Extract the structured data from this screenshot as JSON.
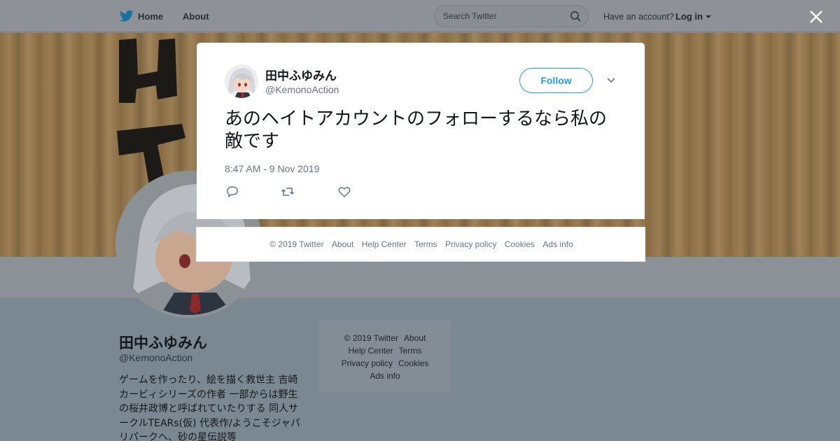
{
  "nav": {
    "home_label": "Home",
    "about_label": "About",
    "search_placeholder": "Search Twitter",
    "account_prompt": "Have an account?",
    "login_label": "Log in"
  },
  "profile": {
    "name": "田中ふゆみん",
    "handle": "@KemonoAction",
    "bio": "ゲームを作ったり、絵を描く救世主 吉崎カービィシリーズの作者 一部からは野生の桜井政博と呼ばれていたりする 同人サークルTEARs(仮) 代表作/ようこそジャパリパークへ、砂の星伝説等"
  },
  "side_footer": {
    "links": [
      "© 2019 Twitter",
      "About",
      "Help Center",
      "Terms",
      "Privacy policy",
      "Cookies",
      "Ads info"
    ]
  },
  "tweet": {
    "author_name": "田中ふゆみん",
    "author_handle": "@KemonoAction",
    "follow_label": "Follow",
    "text": "あのヘイトアカウントのフォローするなら私の敵です",
    "timestamp": "8:47 AM - 9 Nov 2019"
  },
  "modal_footer": {
    "links": [
      "© 2019 Twitter",
      "About",
      "Help Center",
      "Terms",
      "Privacy policy",
      "Cookies",
      "Ads info"
    ]
  },
  "colors": {
    "accent": "#1da1f2",
    "secondary_text": "#657786",
    "overlay": "#7f8a93"
  },
  "icons": {
    "logo": "twitter-bird-icon",
    "search": "search-icon",
    "close": "close-icon",
    "chevron": "chevron-down-icon",
    "reply": "reply-icon",
    "retweet": "retweet-icon",
    "like": "heart-icon"
  }
}
